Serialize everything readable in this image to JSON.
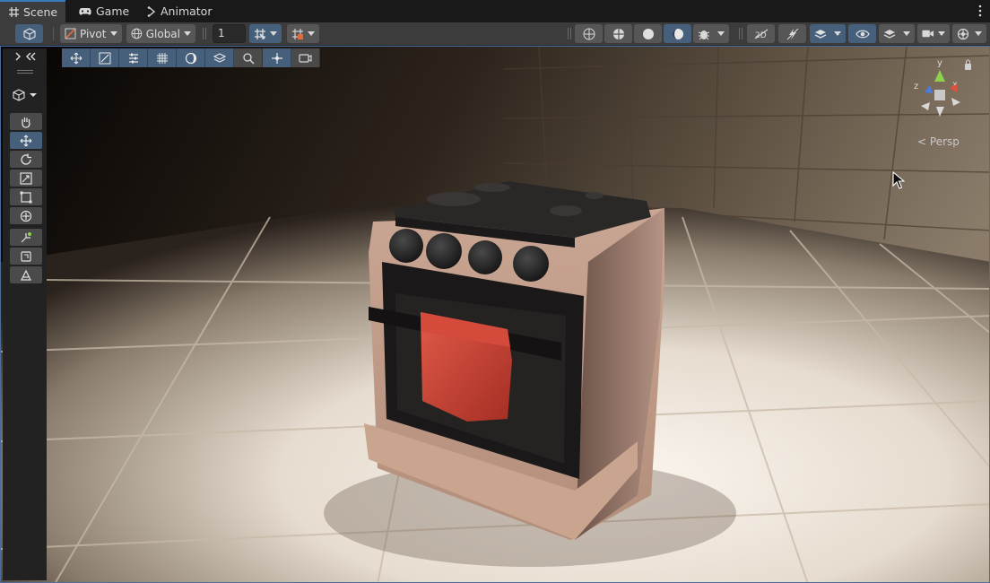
{
  "tabs": [
    {
      "label": "Scene",
      "icon": "grid-hash-icon",
      "active": true
    },
    {
      "label": "Game",
      "icon": "gamepad-icon",
      "active": false
    },
    {
      "label": "Animator",
      "icon": "animator-icon",
      "active": false
    }
  ],
  "toolbar": {
    "pivot_label": "Pivot",
    "global_label": "Global",
    "snap_value": "1"
  },
  "scene": {
    "camera_mode_label": "Persp",
    "gizmo_axes": {
      "y": "y",
      "x": "x",
      "z": "z"
    }
  },
  "colors": {
    "accent": "#3a79bb",
    "active_button": "#46607c",
    "panel": "#3c3c3c",
    "background": "#191919",
    "gizmo_y": "#8fd14f",
    "gizmo_x": "#e0503a",
    "gizmo_z": "#4a7be0"
  }
}
